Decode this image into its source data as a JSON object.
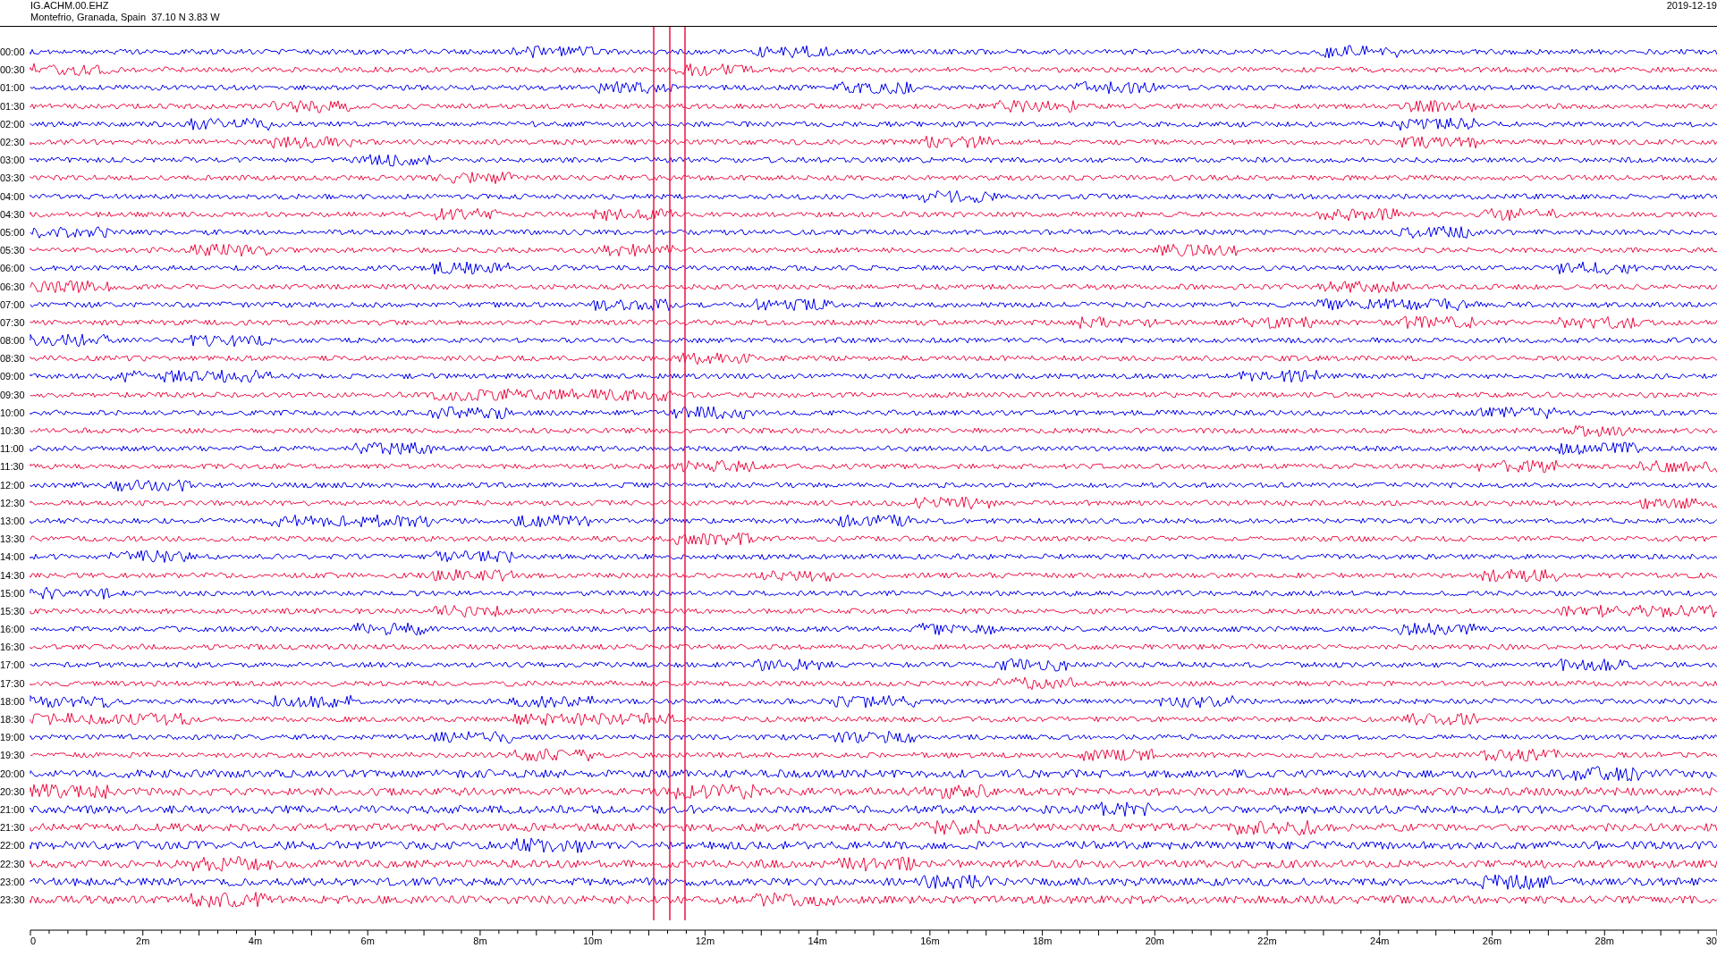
{
  "header": {
    "station": "IG.ACHM.00.EHZ",
    "location": "Montefrio, Granada, Spain  37.10 N 3.83 W",
    "date": "2019-12-19"
  },
  "traces": [
    {
      "time": "00:00",
      "color": "#0000ee"
    },
    {
      "time": "00:30",
      "color": "#ee1144"
    },
    {
      "time": "01:00",
      "color": "#0000ee"
    },
    {
      "time": "01:30",
      "color": "#ee1144"
    },
    {
      "time": "02:00",
      "color": "#0000ee"
    },
    {
      "time": "02:30",
      "color": "#ee1144"
    },
    {
      "time": "03:00",
      "color": "#0000ee"
    },
    {
      "time": "03:30",
      "color": "#ee1144"
    },
    {
      "time": "04:00",
      "color": "#0000ee"
    },
    {
      "time": "04:30",
      "color": "#ee1144"
    },
    {
      "time": "05:00",
      "color": "#0000ee"
    },
    {
      "time": "05:30",
      "color": "#ee1144"
    },
    {
      "time": "06:00",
      "color": "#0000ee"
    },
    {
      "time": "06:30",
      "color": "#ee1144"
    },
    {
      "time": "07:00",
      "color": "#0000ee"
    },
    {
      "time": "07:30",
      "color": "#ee1144"
    },
    {
      "time": "08:00",
      "color": "#0000ee"
    },
    {
      "time": "08:30",
      "color": "#ee1144"
    },
    {
      "time": "09:00",
      "color": "#0000ee"
    },
    {
      "time": "09:30",
      "color": "#ee1144"
    },
    {
      "time": "10:00",
      "color": "#0000ee"
    },
    {
      "time": "10:30",
      "color": "#ee1144"
    },
    {
      "time": "11:00",
      "color": "#0000ee"
    },
    {
      "time": "11:30",
      "color": "#ee1144"
    },
    {
      "time": "12:00",
      "color": "#0000ee"
    },
    {
      "time": "12:30",
      "color": "#ee1144"
    },
    {
      "time": "13:00",
      "color": "#0000ee"
    },
    {
      "time": "13:30",
      "color": "#ee1144"
    },
    {
      "time": "14:00",
      "color": "#0000ee"
    },
    {
      "time": "14:30",
      "color": "#ee1144"
    },
    {
      "time": "15:00",
      "color": "#0000ee"
    },
    {
      "time": "15:30",
      "color": "#ee1144"
    },
    {
      "time": "16:00",
      "color": "#0000ee"
    },
    {
      "time": "16:30",
      "color": "#ee1144"
    },
    {
      "time": "17:00",
      "color": "#0000ee"
    },
    {
      "time": "17:30",
      "color": "#ee1144"
    },
    {
      "time": "18:00",
      "color": "#0000ee"
    },
    {
      "time": "18:30",
      "color": "#ee1144"
    },
    {
      "time": "19:00",
      "color": "#0000ee"
    },
    {
      "time": "19:30",
      "color": "#ee1144"
    },
    {
      "time": "20:00",
      "color": "#0000ee"
    },
    {
      "time": "20:30",
      "color": "#ee1144"
    },
    {
      "time": "21:00",
      "color": "#0000ee"
    },
    {
      "time": "21:30",
      "color": "#ee1144"
    },
    {
      "time": "22:00",
      "color": "#0000ee"
    },
    {
      "time": "22:30",
      "color": "#ee1144"
    },
    {
      "time": "23:00",
      "color": "#0000ee"
    },
    {
      "time": "23:30",
      "color": "#ee1144"
    }
  ],
  "x_axis": {
    "labels": [
      "0",
      "2m",
      "4m",
      "6m",
      "8m",
      "10m",
      "12m",
      "14m",
      "16m",
      "18m",
      "20m",
      "22m",
      "24m",
      "26m",
      "28m",
      "30"
    ]
  }
}
